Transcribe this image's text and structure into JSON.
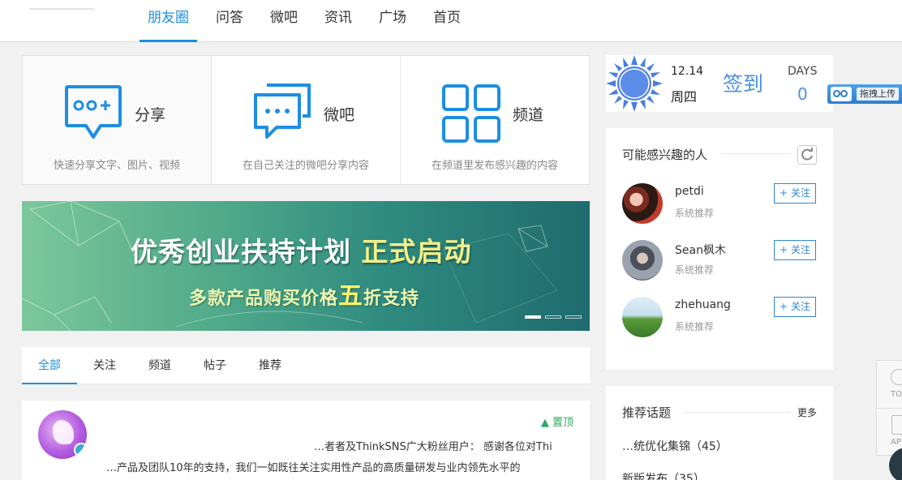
{
  "nav": {
    "items": [
      {
        "label": "朋友圈",
        "active": true
      },
      {
        "label": "问答"
      },
      {
        "label": "微吧"
      },
      {
        "label": "资讯"
      },
      {
        "label": "广场"
      },
      {
        "label": "首页"
      }
    ]
  },
  "cards": [
    {
      "title": "分享",
      "desc": "快速分享文字、图片、视频",
      "icon": "chat-share-icon"
    },
    {
      "title": "微吧",
      "desc": "在自己关注的微吧分享内容",
      "icon": "chat-dots-icon"
    },
    {
      "title": "频道",
      "desc": "在频道里发布感兴趣的内容",
      "icon": "grid-icon"
    }
  ],
  "banner": {
    "title_main": "优秀创业扶持计划",
    "title_highlight": "正式启动",
    "sub_pre": "多款产品购买价格",
    "sub_big": "五",
    "sub_post": "折支持"
  },
  "feed_tabs": [
    "全部",
    "关注",
    "频道",
    "帖子",
    "推荐"
  ],
  "post": {
    "pin_label": "置顶",
    "line1": "…者者及ThinkSNS广大粉丝用户： 感谢各位对Thi",
    "line2": "…产品及团队10年的支持，我们一如既往关注实用性产品的高质量研发与业内领先水平的"
  },
  "checkin": {
    "date": "12.14",
    "weekday": "周四",
    "sign_label": "签到",
    "days_label": "DAYS",
    "days_value": "0"
  },
  "upload": {
    "label": "拖拽上传"
  },
  "people": {
    "title": "可能感兴趣的人",
    "follow_label": "关注",
    "items": [
      {
        "name": "petdi",
        "sub": "系统推荐"
      },
      {
        "name": "Sean枫木",
        "sub": "系统推荐"
      },
      {
        "name": "zhehuang",
        "sub": "系统推荐"
      }
    ]
  },
  "topics": {
    "title": "推荐话题",
    "more": "更多",
    "items": [
      "…统优化集锦（45）",
      "新版发布（35）"
    ]
  },
  "side": {
    "top_label": "TO",
    "app_label": "APP"
  },
  "colors": {
    "accent": "#1d8ee2",
    "green": "#2ea760"
  }
}
